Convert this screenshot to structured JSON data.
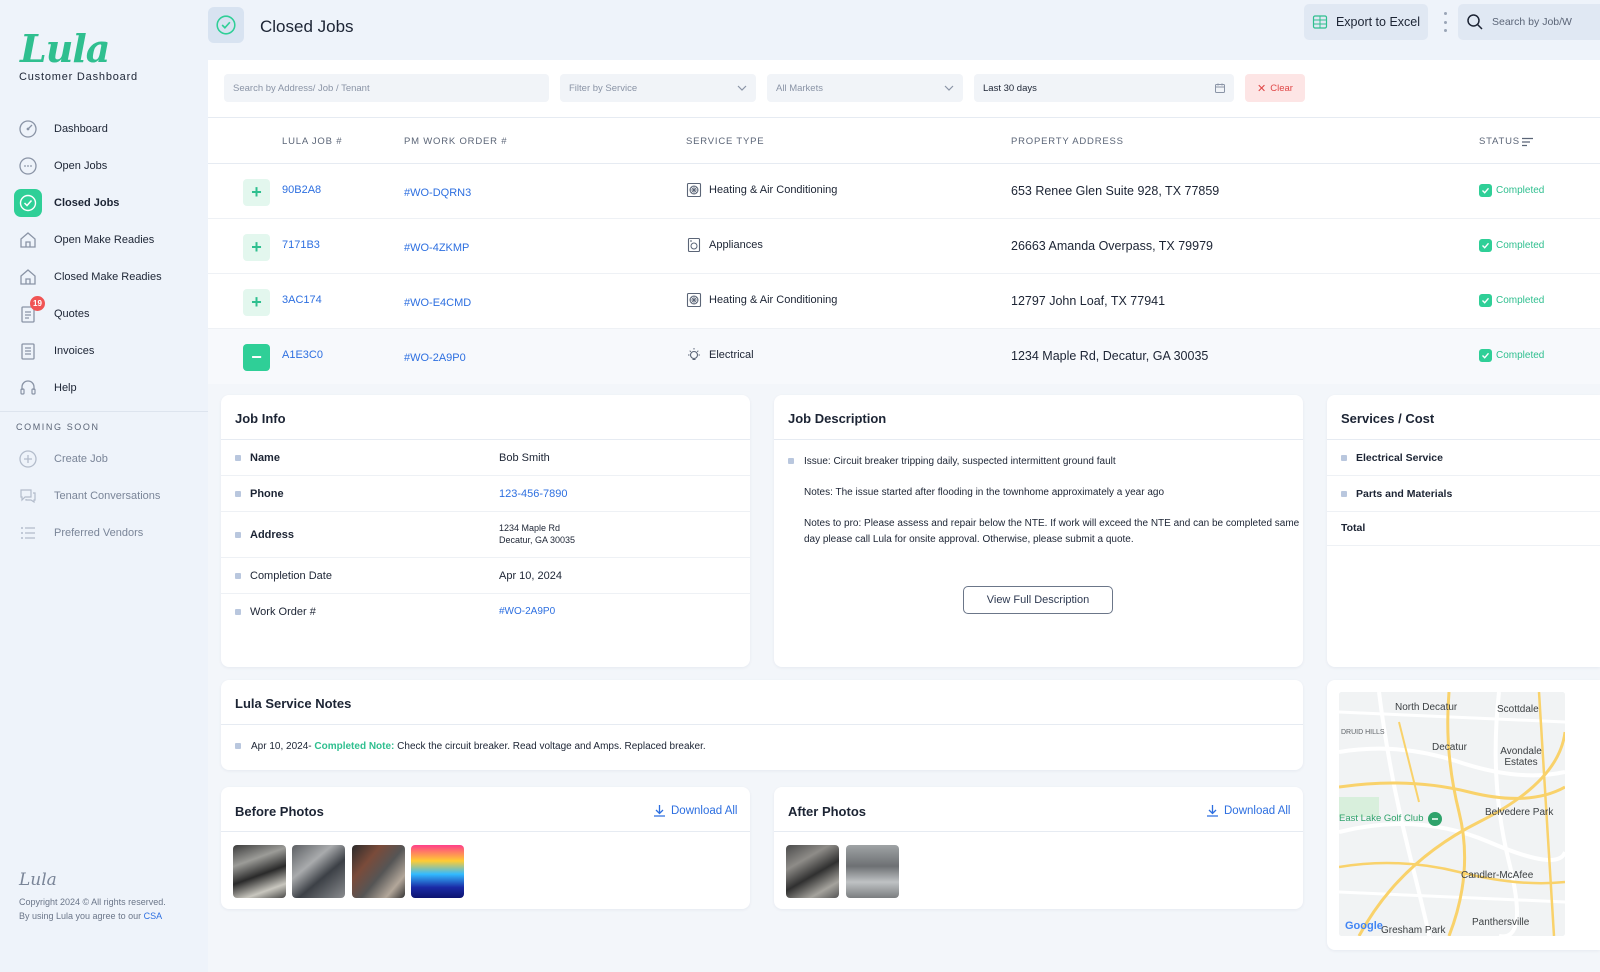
{
  "brand": {
    "logo": "Lula",
    "subtitle": "Customer Dashboard",
    "footer_logo": "Lula",
    "copyright": "Copyright 2024 © All rights reserved.",
    "agree": "By using Lula you agree to our",
    "csa": "CSA"
  },
  "nav": [
    {
      "label": "Dashboard",
      "icon": "dashboard-icon"
    },
    {
      "label": "Open Jobs",
      "icon": "open-jobs-icon"
    },
    {
      "label": "Closed Jobs",
      "icon": "check-circle-icon",
      "active": true
    },
    {
      "label": "Open Make Readies",
      "icon": "house-icon"
    },
    {
      "label": "Closed Make Readies",
      "icon": "house-icon"
    },
    {
      "label": "Quotes",
      "icon": "quotes-icon",
      "badge": "19"
    },
    {
      "label": "Invoices",
      "icon": "invoice-icon"
    },
    {
      "label": "Help",
      "icon": "headset-icon"
    }
  ],
  "coming_soon": {
    "header": "COMING SOON",
    "items": [
      {
        "label": "Create Job"
      },
      {
        "label": "Tenant Conversations"
      },
      {
        "label": "Preferred Vendors"
      }
    ]
  },
  "topbar": {
    "title": "Closed Jobs",
    "export": "Export to Excel",
    "search_placeholder": "Search by Job/W"
  },
  "filters": {
    "search": "Search by Address/ Job / Tenant",
    "service": "Filter by Service",
    "markets": "All Markets",
    "date": "Last 30 days",
    "clear": "Clear"
  },
  "table": {
    "headers": {
      "job": "LULA JOB #",
      "wo": "PM WORK ORDER #",
      "service": "SERVICE TYPE",
      "address": "PROPERTY ADDRESS",
      "status": "STATUS"
    },
    "rows": [
      {
        "job": "90B2A8",
        "wo": "#WO-DQRN3",
        "service": "Heating & Air Conditioning",
        "address": "653 Renee Glen Suite 928, TX 77859",
        "status": "Completed"
      },
      {
        "job": "7171B3",
        "wo": "#WO-4ZKMP",
        "service": "Appliances",
        "address": "26663 Amanda Overpass, TX 79979",
        "status": "Completed"
      },
      {
        "job": "3AC174",
        "wo": "#WO-E4CMD",
        "service": "Heating & Air Conditioning",
        "address": "12797 John Loaf, TX 77941",
        "status": "Completed"
      },
      {
        "job": "A1E3C0",
        "wo": "#WO-2A9P0",
        "service": "Electrical",
        "address": "1234 Maple Rd, Decatur, GA 30035",
        "status": "Completed"
      }
    ]
  },
  "job_info": {
    "title": "Job Info",
    "name_label": "Name",
    "name": "Bob Smith",
    "phone_label": "Phone",
    "phone": "123-456-7890",
    "address_label": "Address",
    "address1": "1234 Maple Rd",
    "address2": "Decatur, GA 30035",
    "date_label": "Completion Date",
    "date": "Apr 10, 2024",
    "wo_label": "Work Order #",
    "wo": "#WO-2A9P0"
  },
  "job_desc": {
    "title": "Job Description",
    "issue": "Issue: Circuit breaker tripping daily, suspected intermittent ground fault",
    "notes": "Notes: The issue started after flooding in the townhome approximately a year ago",
    "pro1": "Notes to pro: Please assess and repair below the NTE. If work will exceed the NTE and can be completed same",
    "pro2": "day please call Lula for onsite approval. Otherwise, please submit a quote.",
    "button": "View Full Description"
  },
  "services": {
    "title": "Services / Cost",
    "item1": "Electrical Service",
    "item2": "Parts and Materials",
    "total": "Total"
  },
  "notes": {
    "title": "Lula Service Notes",
    "date": "Apr 10, 2024-",
    "tag": "Completed Note:",
    "text": "Check the circuit breaker. Read voltage and Amps. Replaced breaker."
  },
  "before": {
    "title": "Before Photos",
    "download": "Download All"
  },
  "after": {
    "title": "After Photos",
    "download": "Download All"
  },
  "map": {
    "labels": [
      "North Decatur",
      "Scottdale",
      "DRUID HILLS",
      "Decatur",
      "Avondale Estates",
      "Belvedere Park",
      "East Lake Golf Club",
      "Candler-McAfee",
      "Panthersville",
      "Gresham Park",
      "Google"
    ]
  },
  "colors": {
    "accent": "#2fcf97",
    "link": "#2d6fe0",
    "danger": "#e04848"
  }
}
